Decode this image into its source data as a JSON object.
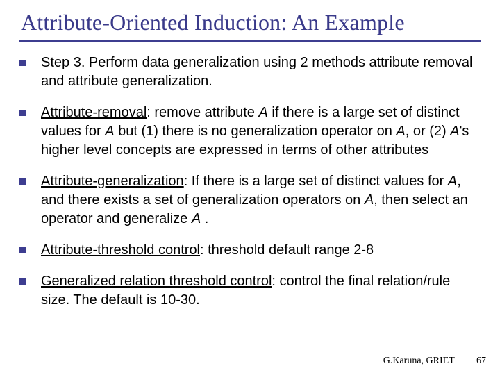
{
  "title": "Attribute-Oriented Induction: An Example",
  "bullets": [
    {
      "pre": "Step 3. Perform data generalization using 2 methods attribute removal and attribute generalization.",
      "u": "",
      "post": ""
    },
    {
      "pre": "",
      "u": "Attribute-removal",
      "post_parts": [
        ": remove attribute ",
        "A",
        " if there is a large set of distinct values for ",
        "A",
        " but (1) there is no generalization operator on ",
        "A",
        ", or (2) ",
        "A",
        "'s higher level concepts are expressed in terms of other attributes"
      ]
    },
    {
      "pre": "",
      "u": "Attribute-generalization",
      "post_parts": [
        ": If there is a large set of distinct values for ",
        "A",
        ", and there exists a set of generalization operators on ",
        "A",
        ", then select an operator and generalize ",
        "A",
        " ."
      ]
    },
    {
      "pre": "",
      "u": "Attribute-threshold control",
      "post": ": threshold default range 2-8"
    },
    {
      "pre": "",
      "u": "Generalized relation threshold control",
      "post": ": control the final relation/rule size. The default is 10-30."
    }
  ],
  "footer": {
    "author": "G.Karuna, GRIET",
    "page": "67"
  }
}
